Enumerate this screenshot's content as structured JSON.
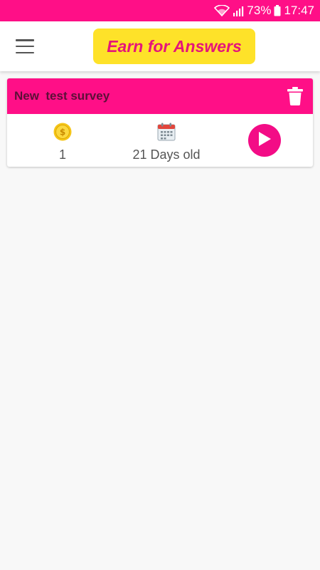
{
  "status_bar": {
    "battery_percent": "73%",
    "time": "17:47",
    "icons": [
      "wifi-icon",
      "signal-icon",
      "battery-icon"
    ]
  },
  "app_bar": {
    "menu_icon": "hamburger-menu-icon",
    "logo_text": "Earn for Answers"
  },
  "surveys": [
    {
      "title": "New  test survey",
      "coins": "1",
      "age": "21 Days old",
      "icons": {
        "coins": "coin-icon",
        "age": "calendar-icon",
        "delete": "trash-icon",
        "start": "play-icon"
      }
    }
  ],
  "colors": {
    "primary": "#ff0f87",
    "logo_bg": "#fee229",
    "logo_text": "#e5157a",
    "card_title": "#5b1037",
    "background": "#f8f8f8"
  }
}
